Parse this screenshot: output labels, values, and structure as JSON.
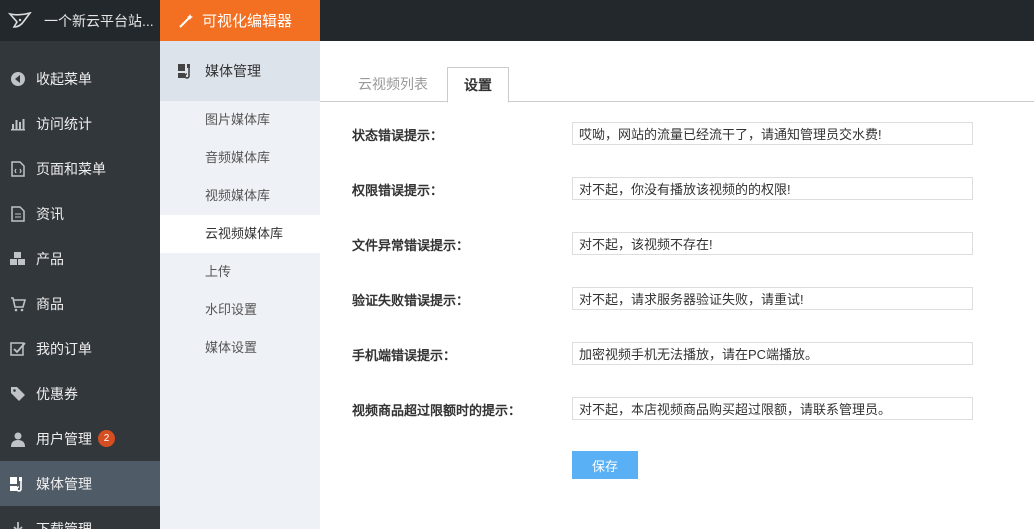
{
  "header": {
    "site_name": "一个新云平台站...",
    "editor_label": "可视化编辑器"
  },
  "sidebar": {
    "items": [
      {
        "label": "收起菜单",
        "icon": "collapse-icon"
      },
      {
        "label": "访问统计",
        "icon": "chart-icon"
      },
      {
        "label": "页面和菜单",
        "icon": "page-icon"
      },
      {
        "label": "资讯",
        "icon": "document-icon"
      },
      {
        "label": "产品",
        "icon": "cubes-icon"
      },
      {
        "label": "商品",
        "icon": "cart-icon"
      },
      {
        "label": "我的订单",
        "icon": "checkbox-icon"
      },
      {
        "label": "优惠券",
        "icon": "tag-icon"
      },
      {
        "label": "用户管理",
        "icon": "user-icon",
        "badge": "2"
      },
      {
        "label": "媒体管理",
        "icon": "media-icon"
      },
      {
        "label": "下载管理",
        "icon": "download-icon"
      }
    ]
  },
  "submenu": {
    "title": "媒体管理",
    "items": [
      "图片媒体库",
      "音频媒体库",
      "视频媒体库",
      "云视频媒体库",
      "上传",
      "水印设置",
      "媒体设置"
    ]
  },
  "tabs": [
    "云视频列表",
    "设置"
  ],
  "form": {
    "rows": [
      {
        "label": "状态错误提示：",
        "value": "哎呦，网站的流量已经流干了，请通知管理员交水费!"
      },
      {
        "label": "权限错误提示：",
        "value": "对不起，你没有播放该视频的的权限!"
      },
      {
        "label": "文件异常错误提示：",
        "value": "对不起，该视频不存在!"
      },
      {
        "label": "验证失败错误提示：",
        "value": "对不起，请求服务器验证失败，请重试!"
      },
      {
        "label": "手机端错误提示：",
        "value": "加密视频手机无法播放，请在PC端播放。"
      },
      {
        "label": "视频商品超过限额时的提示：",
        "value": "对不起，本店视频商品购买超过限额，请联系管理员。"
      }
    ],
    "save_label": "保存"
  },
  "colors": {
    "accent": "#f36f21",
    "sidebar_bg": "#32373c",
    "save_button": "#5ab0f5"
  }
}
